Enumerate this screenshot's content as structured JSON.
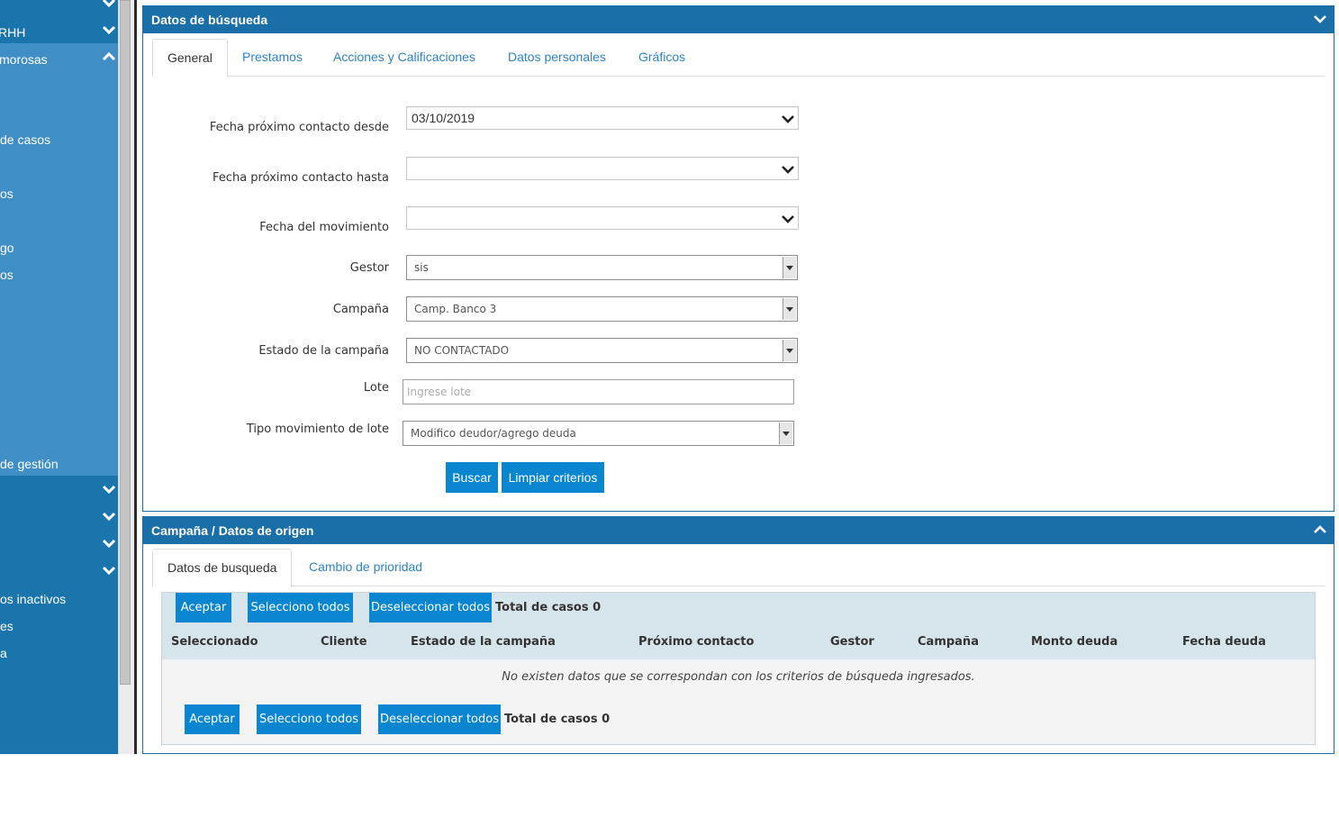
{
  "sidebar": {
    "items": [
      {
        "label": "RHH"
      },
      {
        "label": "morosas"
      },
      {
        "label": "de casos"
      },
      {
        "label": "os"
      },
      {
        "label": "go"
      },
      {
        "label": "os"
      },
      {
        "label": "de gestión"
      },
      {
        "label": "os inactivos"
      },
      {
        "label": "es"
      },
      {
        "label": "a"
      }
    ]
  },
  "search_panel": {
    "title": "Datos de búsqueda",
    "tabs": [
      {
        "label": "General"
      },
      {
        "label": "Prestamos"
      },
      {
        "label": "Acciones y Calificaciones"
      },
      {
        "label": "Datos personales"
      },
      {
        "label": "Gráficos"
      }
    ],
    "fields": {
      "fecha_desde": {
        "label": "Fecha próximo contacto desde",
        "value": "03/10/2019"
      },
      "fecha_hasta": {
        "label": "Fecha próximo contacto hasta",
        "value": ""
      },
      "fecha_movimiento": {
        "label": "Fecha del movimiento",
        "value": ""
      },
      "gestor": {
        "label": "Gestor",
        "value": "sis"
      },
      "campana": {
        "label": "Campaña",
        "value": "Camp. Banco 3"
      },
      "estado_campana": {
        "label": "Estado de la campaña",
        "value": "NO CONTACTADO"
      },
      "lote": {
        "label": "Lote",
        "placeholder": "Ingrese lote"
      },
      "tipo_movimiento": {
        "label": "Tipo movimiento de lote",
        "value": "Modifico deudor/agrego deuda"
      }
    },
    "buttons": {
      "buscar": "Buscar",
      "limpiar": "Limpiar criterios"
    }
  },
  "origin_panel": {
    "title": "Campaña / Datos de origen",
    "tabs": [
      {
        "label": "Datos de busqueda"
      },
      {
        "label": "Cambio de prioridad"
      }
    ],
    "toolbar": {
      "aceptar": "Aceptar",
      "seleccionar_todos": "Selecciono todos",
      "deseleccionar_todos": "Deseleccionar todos",
      "total": "Total de casos 0"
    },
    "table": {
      "columns": [
        "Seleccionado",
        "Cliente",
        "Estado de la campaña",
        "Próximo contacto",
        "Gestor",
        "Campaña",
        "Monto deuda",
        "Fecha deuda"
      ],
      "empty_message": "No existen datos que se correspondan con los criterios de búsqueda ingresados."
    }
  },
  "colors": {
    "header_blue": "#1b6fa8",
    "button_blue": "#0a86d0",
    "sidebar_blue": "#1a75ad",
    "sidebar_active": "#3f8fc6",
    "link_blue": "#2d84c9"
  }
}
